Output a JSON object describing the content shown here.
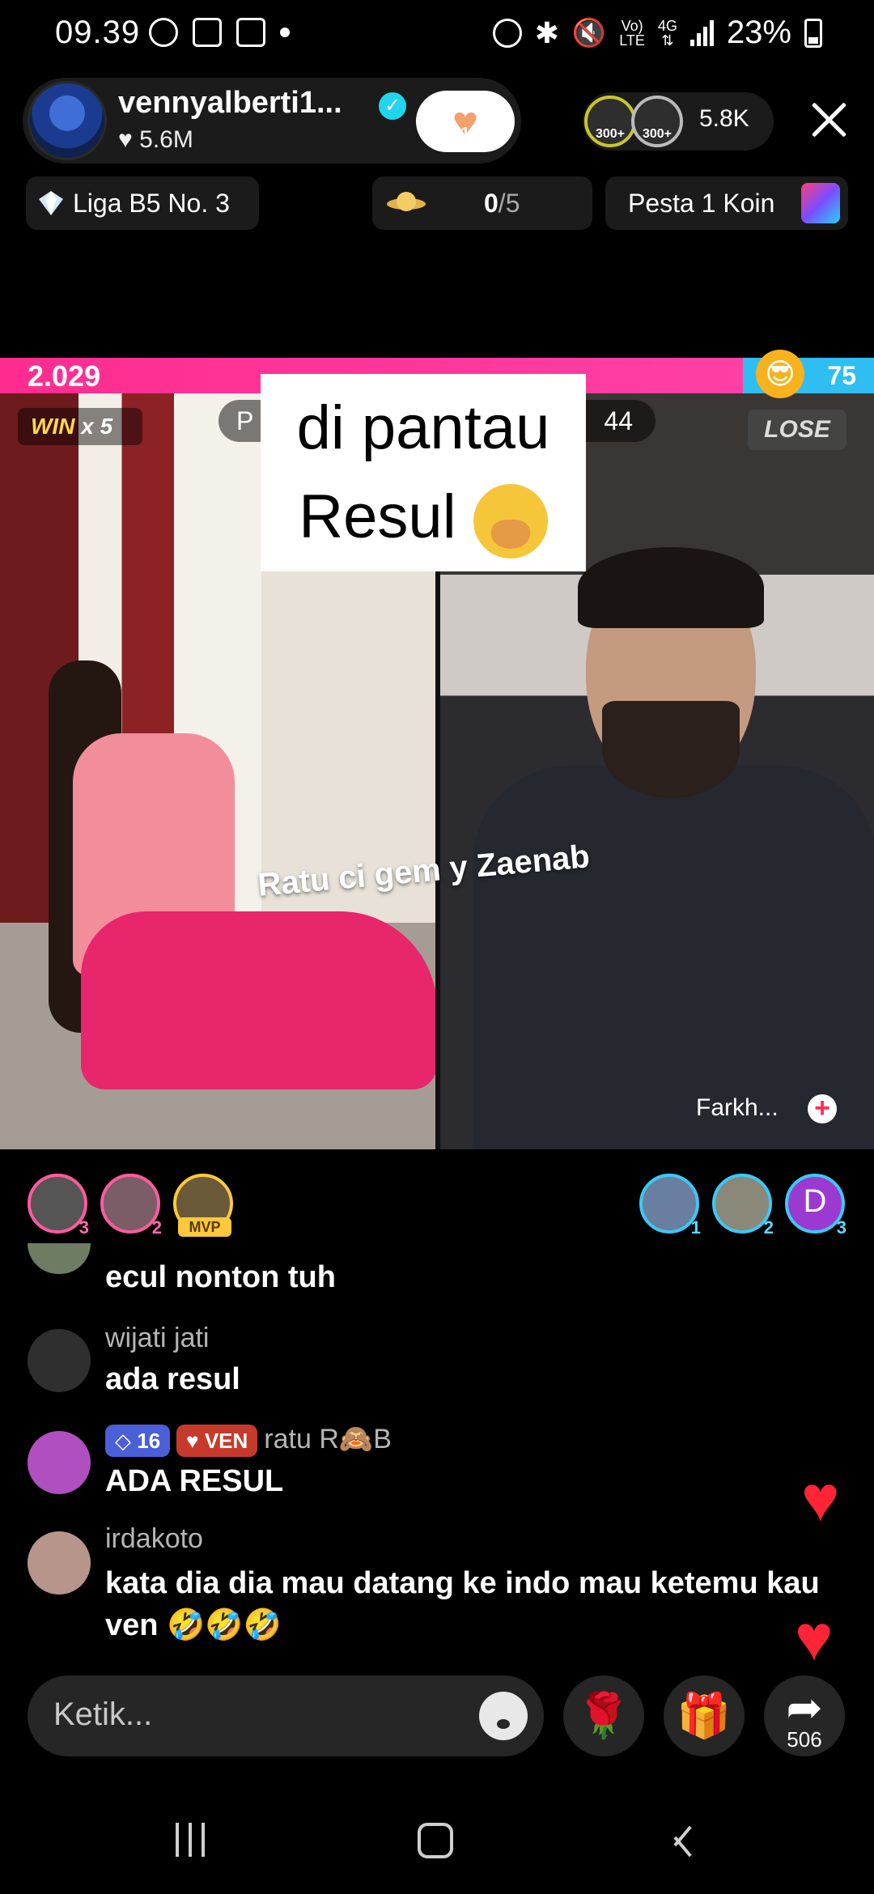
{
  "status_bar": {
    "time": "09.39",
    "battery": "23%",
    "network_top": "Vo)",
    "network_bottom": "LTE",
    "gen_top": "4G"
  },
  "host": {
    "name": "vennyalberti1...",
    "likes": "5.6M",
    "follow_heart_count": "1",
    "viewer_badges": [
      "300+",
      "300+"
    ],
    "viewer_count": "5.8K"
  },
  "pills": {
    "league": "Liga B5 No. 3",
    "goal_current": "0",
    "goal_total": "/5",
    "event": "Pesta 1 Koin"
  },
  "battle": {
    "score_left": "2.029",
    "score_right": "75",
    "win_label": "WIN",
    "win_multiplier": "x 5",
    "lose_label": "LOSE",
    "mid_left": "P",
    "mid_right": "44",
    "caption_line1": "di pantau",
    "caption_line2": "Resul",
    "overlay_text": "Ratu ci gem   y Zaenab",
    "opponent_name": "Farkh..."
  },
  "ranking": {
    "left": [
      {
        "rank": "3"
      },
      {
        "rank": "2"
      },
      {
        "tag": "MVP"
      }
    ],
    "right": [
      {
        "rank": "1"
      },
      {
        "rank": "2"
      },
      {
        "letter": "D",
        "rank": "3"
      }
    ]
  },
  "comments": [
    {
      "user": "",
      "text": "ecul nonton tuh"
    },
    {
      "user": "wijati jati",
      "text": "ada resul"
    },
    {
      "level": "16",
      "fan_badge": "VEN",
      "user": "ratu R🙈B",
      "text": "ADA RESUL"
    },
    {
      "user": "irdakoto",
      "text": "kata dia dia mau datang ke indo mau ketemu kau ven 🤣🤣🤣"
    }
  ],
  "bottom": {
    "input_placeholder": "Ketik...",
    "share_count": "506"
  },
  "colors": {
    "score_pink": "#ff2c8f",
    "score_blue": "#2fbef2",
    "heart_red": "#ff2436",
    "verified": "#20d5ec"
  }
}
